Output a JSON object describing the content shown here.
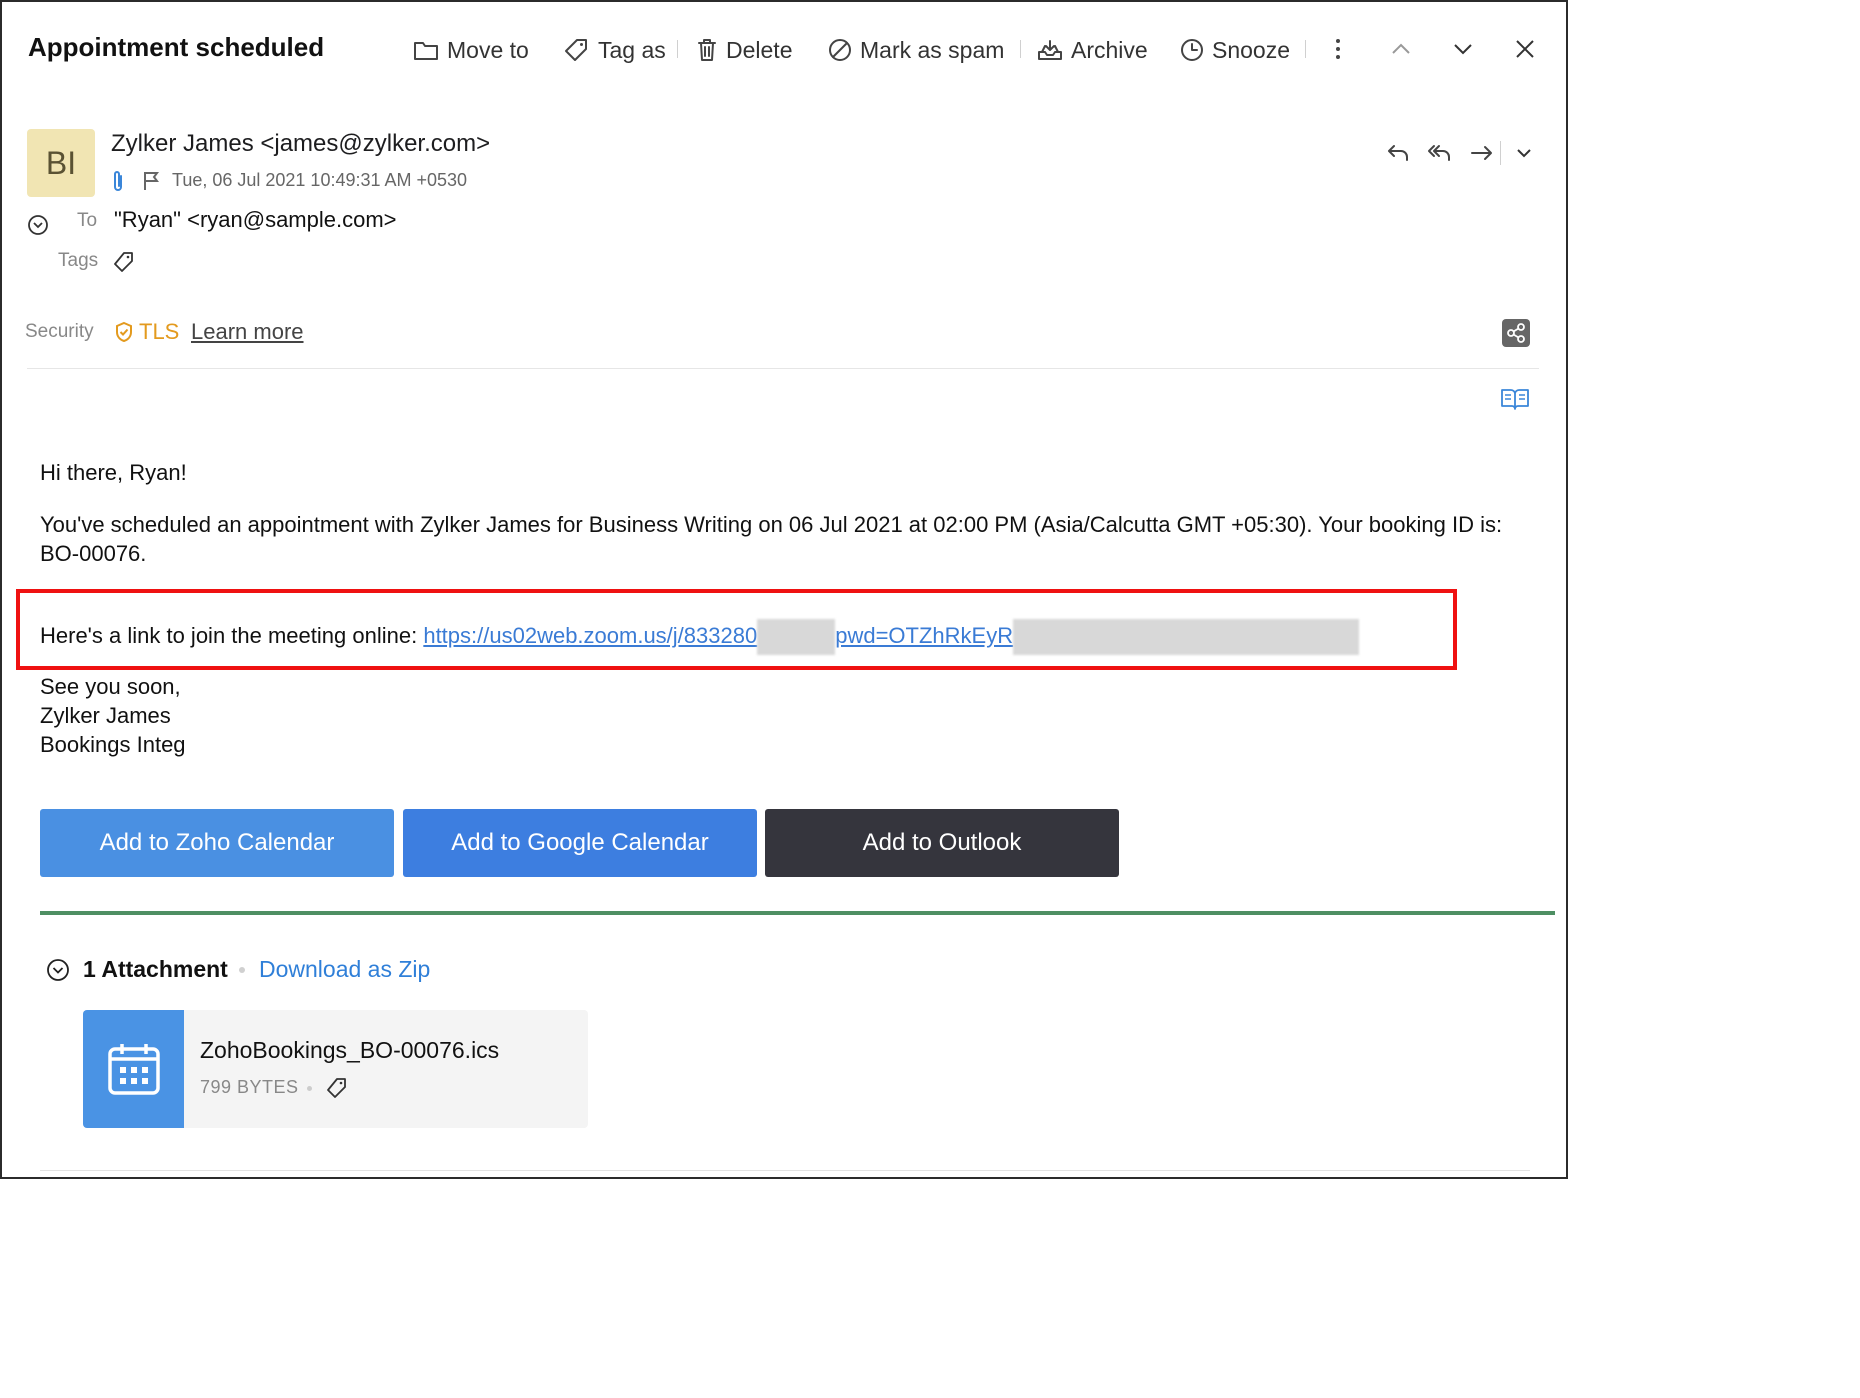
{
  "header": {
    "title": "Appointment scheduled",
    "toolbar": {
      "move_to": "Move to",
      "tag_as": "Tag as",
      "delete": "Delete",
      "mark_as_spam": "Mark as spam",
      "archive": "Archive",
      "snooze": "Snooze"
    }
  },
  "sender": {
    "initials": "BI",
    "from": "Zylker James <james@zylker.com>",
    "date": "Tue, 06 Jul 2021 10:49:31 AM +0530",
    "to_label": "To",
    "to_value": "\"Ryan\" <ryan@sample.com>",
    "tags_label": "Tags",
    "security_label": "Security",
    "security_value": "TLS",
    "learn_more": "Learn more"
  },
  "body": {
    "greeting": "Hi there, Ryan!",
    "paragraph1": "You've scheduled an appointment with Zylker James for Business Writing on 06 Jul 2021 at 02:00 PM (Asia/Calcutta GMT +05:30). Your booking ID is: BO-00076.",
    "link_intro": "Here's a link to join the meeting online:",
    "link_part1": "https://us02web.zoom.us/j/833280",
    "link_part2": "pwd=OTZhRkEyR",
    "signoff": "See you soon,",
    "signature_name": "Zylker James",
    "signature_org": "Bookings Integ"
  },
  "buttons": {
    "zoho": "Add to Zoho Calendar",
    "google": "Add to Google Calendar",
    "outlook": "Add to Outlook",
    "colors": {
      "zoho": "#4a90e2",
      "google": "#3d7ee0",
      "outlook": "#35353d"
    }
  },
  "attachments": {
    "title": "1 Attachment",
    "download": "Download as Zip",
    "file_name": "ZohoBookings_BO-00076.ics",
    "file_size": "799 BYTES"
  },
  "icons": [
    "folder-icon",
    "tag-icon",
    "trash-icon",
    "spam-icon",
    "archive-icon",
    "clock-icon",
    "more-icon",
    "chevron-up-icon",
    "chevron-down-icon",
    "close-icon",
    "attachment-clip-icon",
    "flag-icon",
    "expand-icon",
    "shield-icon",
    "share-icon",
    "reading-mode-icon",
    "reply-icon",
    "reply-all-icon",
    "forward-icon",
    "calendar-icon"
  ]
}
